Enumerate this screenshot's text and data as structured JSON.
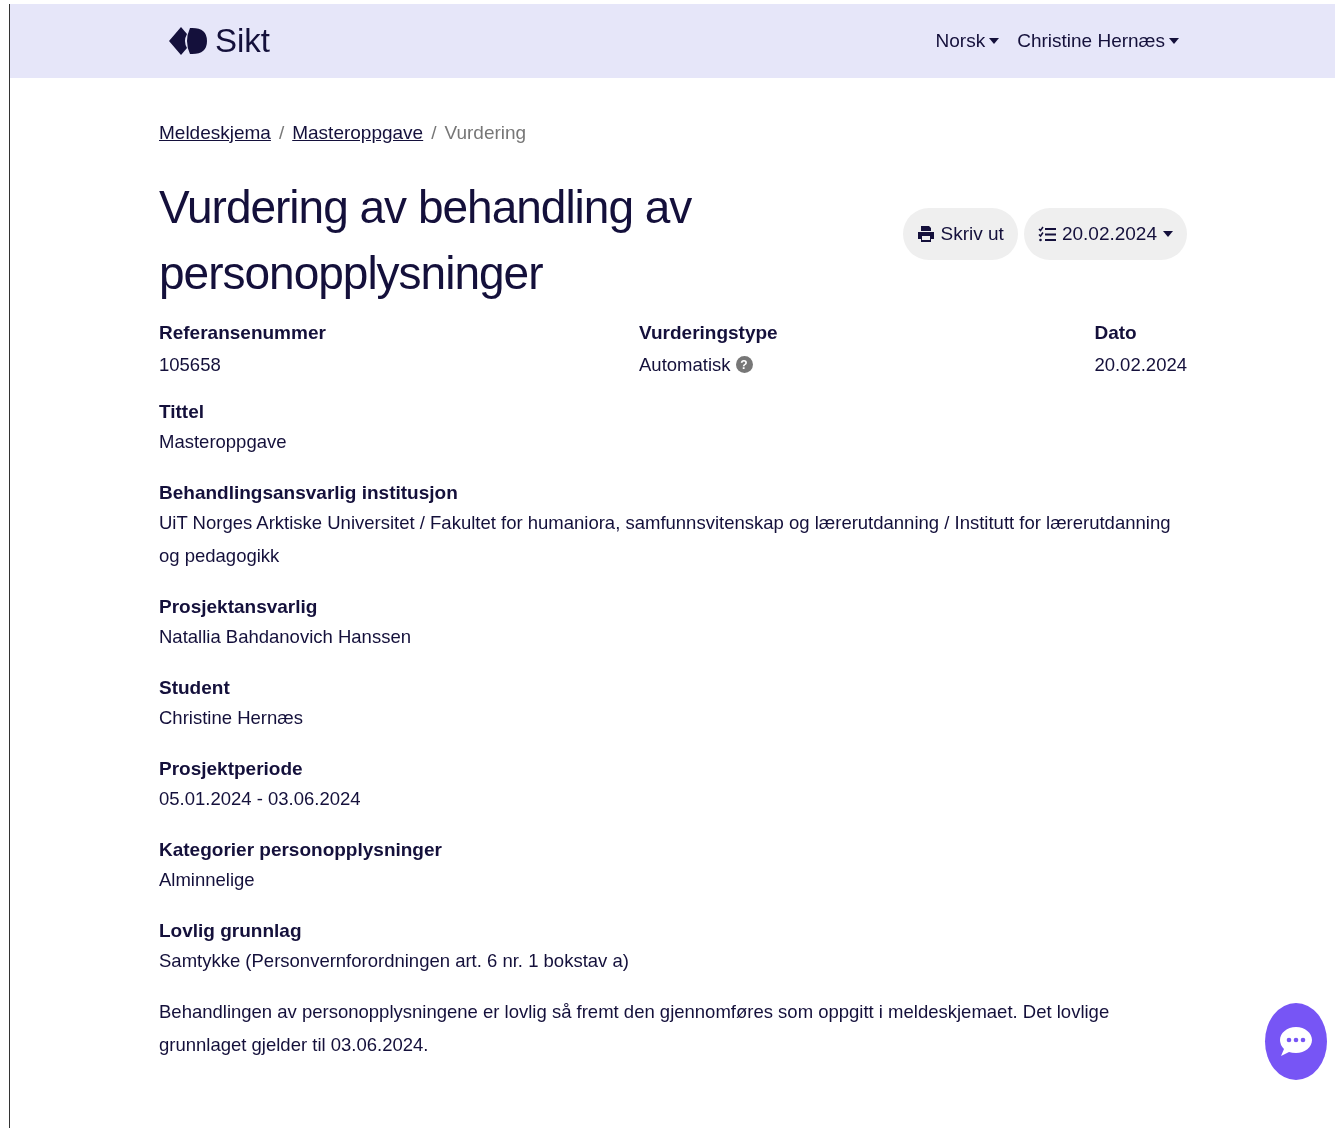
{
  "header": {
    "logo": "Sikt",
    "menus": [
      {
        "label": "Norsk"
      },
      {
        "label": "Christine Hernæs"
      }
    ]
  },
  "breadcrumb": {
    "separator": "/",
    "items": [
      {
        "label": "Meldeskjema",
        "current": false
      },
      {
        "label": "Masteroppgave",
        "current": false
      },
      {
        "label": "Vurdering",
        "current": true
      }
    ]
  },
  "title": "Vurdering av behandling av personopplysninger",
  "actions": [
    {
      "kind": "print",
      "label": "Skriv ut"
    },
    {
      "kind": "version",
      "label": "20.02.2024"
    }
  ],
  "summary": [
    {
      "label": "Referansenummer",
      "value": "105658"
    },
    {
      "label": "Vurderingstype",
      "value": "Automatisk",
      "help": "?"
    },
    {
      "label": "Dato",
      "value": "20.02.2024"
    }
  ],
  "fields": [
    {
      "label": "Tittel",
      "value": "Masteroppgave"
    },
    {
      "label": "Behandlingsansvarlig institusjon",
      "value": "UiT Norges Arktiske Universitet / Fakultet for humaniora, samfunnsvitenskap og lærerutdanning / Institutt for lærerutdanning og pedagogikk"
    },
    {
      "label": "Prosjektansvarlig",
      "value": "Natallia Bahdanovich Hanssen"
    },
    {
      "label": "Student",
      "value": "Christine Hernæs"
    },
    {
      "label": "Prosjektperiode",
      "value": "05.01.2024 - 03.06.2024"
    },
    {
      "label": "Kategorier personopplysninger",
      "value": "Alminnelige"
    },
    {
      "label": "Lovlig grunnlag",
      "value": "Samtykke (Personvernforordningen art. 6 nr. 1 bokstav a)"
    }
  ],
  "paragraph": "Behandlingen av personopplysningene er lovlig så fremt den gjennomføres som oppgitt i meldeskjemaet. Det lovlige grunnlaget gjelder til 03.06.2024."
}
